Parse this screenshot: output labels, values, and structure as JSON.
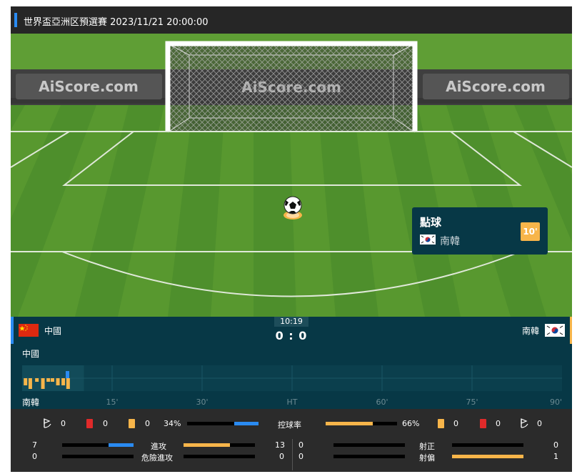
{
  "header": {
    "title": "世界盃亞洲区預選賽 2023/11/21 20:00:00"
  },
  "pitch": {
    "watermarks": [
      "AiScore.com",
      "AiScore.com",
      "AiScore.com"
    ]
  },
  "event": {
    "title": "點球",
    "team": "南韓",
    "minute": "10'"
  },
  "match": {
    "home_team": "中國",
    "away_team": "南韓",
    "clock": "10:19",
    "score": "0 : 0"
  },
  "timeline": {
    "home_label": "中國",
    "away_label": "南韓",
    "ticks": [
      "15'",
      "30'",
      "HT",
      "60'",
      "75'",
      "90'"
    ],
    "progress_minutes": 10.3,
    "home_bars": [
      {
        "minute": 7.5,
        "level": 2
      }
    ],
    "away_bars": [
      {
        "minute": 0.5,
        "level": 2
      },
      {
        "minute": 1.3,
        "level": 3
      },
      {
        "minute": 2.4,
        "level": 1
      },
      {
        "minute": 3.4,
        "level": 3
      },
      {
        "minute": 4.3,
        "level": 1
      },
      {
        "minute": 5.0,
        "level": 1
      },
      {
        "minute": 5.9,
        "level": 2
      },
      {
        "minute": 6.8,
        "level": 2
      },
      {
        "minute": 7.6,
        "level": 3
      }
    ]
  },
  "stats": {
    "home": {
      "corners": "0",
      "red": "0",
      "yellow": "0",
      "attacks": "7",
      "dangerous_attacks": "0",
      "shots_on": "0",
      "shots_off": "0"
    },
    "away": {
      "corners": "0",
      "red": "0",
      "yellow": "0",
      "attacks": "13",
      "dangerous_attacks": "0",
      "shots_on": "0",
      "shots_off": "1"
    },
    "possession": {
      "label": "控球率",
      "home": "34%",
      "away": "66%",
      "home_value": 34,
      "away_value": 66
    },
    "labels": {
      "attacks": "進攻",
      "dangerous_attacks": "危險進攻",
      "shots_on": "射正",
      "shots_off": "射偏"
    }
  },
  "colors": {
    "home": "#2a8bf2",
    "away": "#f7b54a",
    "red_card": "#e02a2a",
    "panel": "#073846"
  }
}
